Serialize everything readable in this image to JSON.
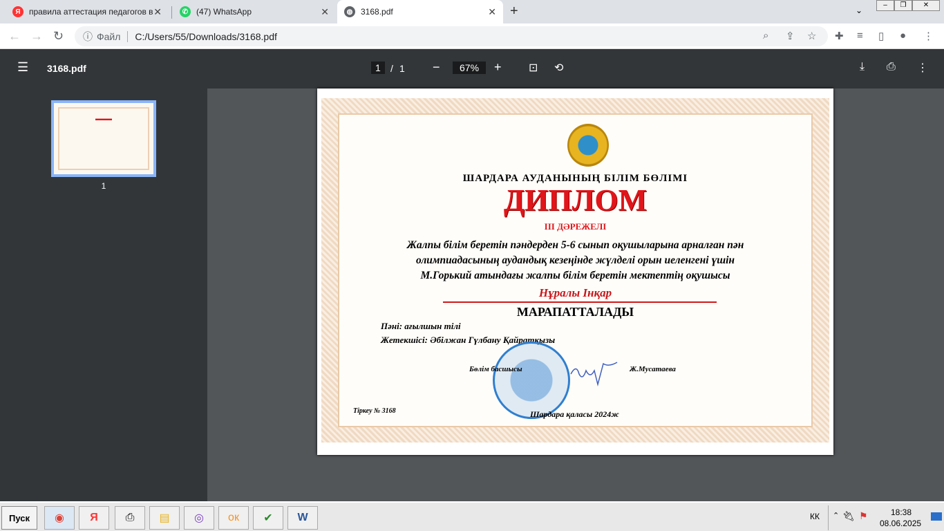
{
  "browser": {
    "tabs": [
      {
        "title": "правила аттестация педагогов в к",
        "icon": "yandex-icon"
      },
      {
        "title": "(47) WhatsApp",
        "icon": "whatsapp-icon"
      },
      {
        "title": "3168.pdf",
        "icon": "globe-icon",
        "active": true
      }
    ],
    "address": {
      "scheme_label": "Файл",
      "url": "C:/Users/55/Downloads/3168.pdf"
    }
  },
  "pdf": {
    "filename": "3168.pdf",
    "page_current": "1",
    "page_sep": "/",
    "page_total": "1",
    "zoom": "67%",
    "thumb_label": "1"
  },
  "certificate": {
    "department": "ШАРДАРА АУДАНЫНЫҢ БІЛІМ БӨЛІМІ",
    "title": "ДИПЛОМ",
    "degree": "ІІІ ДӘРЕЖЕЛІ",
    "text_lines": [
      "Жалпы білім беретін пәндерден 5-6 сынып оқушыларына арналған пән",
      "олимпиадасының аудандық кезеңінде жүлделі орын иеленгені үшін",
      "М.Горький атындағы жалпы білім беретін мектептің оқушысы"
    ],
    "recipient": "Нұралы Інқар",
    "awarded": "МАРАПАТТАЛАДЫ",
    "subject": "Пәні: ағылшын тілі",
    "teacher": "Жетекшісі: Әбілжан Гүлбану Қайратқызы",
    "signer_title": "Бөлім басшысы",
    "signer_name": "Ж.Мусатаева",
    "registration": "Тіркеу № 3168",
    "place_year": "Шардара қаласы 2024ж"
  },
  "taskbar": {
    "start": "Пуск",
    "lang": "КК",
    "time": "18:38",
    "date": "08.06.2025"
  },
  "colors": {
    "accent_red": "#e0161b",
    "toolbar": "#323639",
    "viewer_bg": "#525659"
  }
}
